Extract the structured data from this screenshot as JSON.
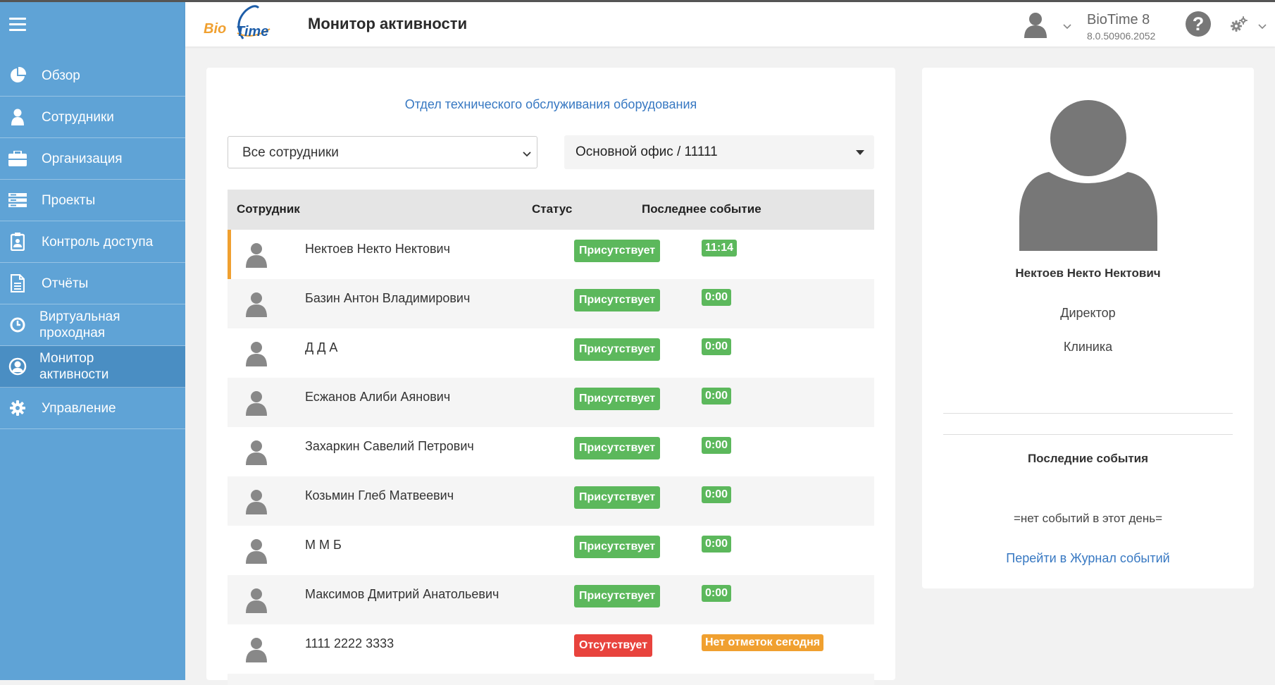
{
  "app": {
    "page_title": "Монитор активности",
    "name": "BioTime 8",
    "version": "8.0.50906.2052",
    "logo_text": "BioTime"
  },
  "sidebar": {
    "items": [
      {
        "label": "Обзор",
        "icon": "pie-chart-icon"
      },
      {
        "label": "Сотрудники",
        "icon": "person-icon"
      },
      {
        "label": "Организация",
        "icon": "briefcase-icon"
      },
      {
        "label": "Проекты",
        "icon": "server-icon"
      },
      {
        "label": "Контроль доступа",
        "icon": "badge-icon"
      },
      {
        "label": "Отчёты",
        "icon": "document-icon"
      },
      {
        "label": "Виртуальная проходная",
        "icon": "clock-icon"
      },
      {
        "label": "Монитор активности",
        "icon": "user-circle-icon",
        "active": true
      },
      {
        "label": "Управление",
        "icon": "gear-icon"
      }
    ]
  },
  "filters": {
    "department_link": "Отдел технического обслуживания оборудования",
    "employees_select": "Все сотрудники",
    "office_select": "Основной офис / 11111"
  },
  "table": {
    "headers": [
      "Сотрудник",
      "Статус",
      "Последнее событие"
    ],
    "rows": [
      {
        "name": "Нектоев Некто Нектович",
        "status": "Присутствует",
        "event": "11:14"
      },
      {
        "name": "Базин Антон Владимирович",
        "status": "Присутствует",
        "event": "0:00"
      },
      {
        "name": "Д Д А",
        "status": "Присутствует",
        "event": "0:00"
      },
      {
        "name": "Есжанов Алиби Аянович",
        "status": "Присутствует",
        "event": "0:00"
      },
      {
        "name": "Захаркин Савелий Петрович",
        "status": "Присутствует",
        "event": "0:00"
      },
      {
        "name": "Козьмин Глеб Матвеевич",
        "status": "Присутствует",
        "event": "0:00"
      },
      {
        "name": "М М Б",
        "status": "Присутствует",
        "event": "0:00"
      },
      {
        "name": "Максимов Дмитрий Анатольевич",
        "status": "Присутствует",
        "event": "0:00"
      },
      {
        "name": "1111 2222 3333",
        "status": "Отсутствует",
        "event": "Нет отметок сегодня"
      }
    ]
  },
  "profile": {
    "name": "Нектоев Некто Нектович",
    "position": "Директор",
    "department": "Клиника",
    "events_title": "Последние события",
    "no_events": "=нет событий в этот день=",
    "journal_link": "Перейти в Журнал событий"
  },
  "colors": {
    "sidebar": "#5fa3d6",
    "present": "#5cb85c",
    "absent": "#e8433d",
    "warning": "#f0a030",
    "link": "#3778c2"
  }
}
